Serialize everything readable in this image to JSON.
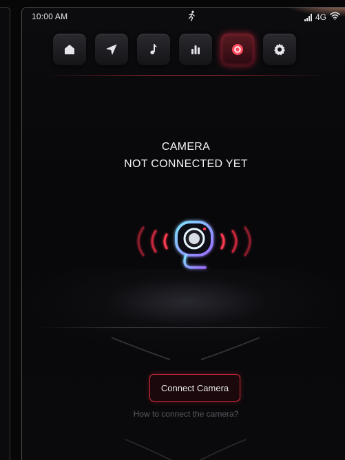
{
  "status_bar": {
    "time": "10:00 AM",
    "network": "4G",
    "center_icon": "running-person-icon",
    "signal_icon": "signal-bars-icon",
    "wifi_icon": "wifi-icon"
  },
  "nav": {
    "items": [
      {
        "id": "home",
        "icon": "home-icon"
      },
      {
        "id": "navigation",
        "icon": "navigation-arrow-icon"
      },
      {
        "id": "music",
        "icon": "music-note-icon"
      },
      {
        "id": "equalizer",
        "icon": "equalizer-icon"
      },
      {
        "id": "camera",
        "icon": "camera-record-icon",
        "active": true
      },
      {
        "id": "settings",
        "icon": "gear-icon"
      }
    ]
  },
  "main": {
    "title_line1": "CAMERA",
    "title_line2": "NOT CONNECTED YET",
    "illustration_icon": "webcam-icon",
    "connect_button_label": "Connect Camera",
    "help_link_text": "How to connect the camera?"
  },
  "colors": {
    "accent": "#d22a3a",
    "glow_cyan": "#6fd6ff",
    "glow_violet": "#8b6cff",
    "text": "#f4f4f6",
    "muted": "#5a5a64"
  }
}
